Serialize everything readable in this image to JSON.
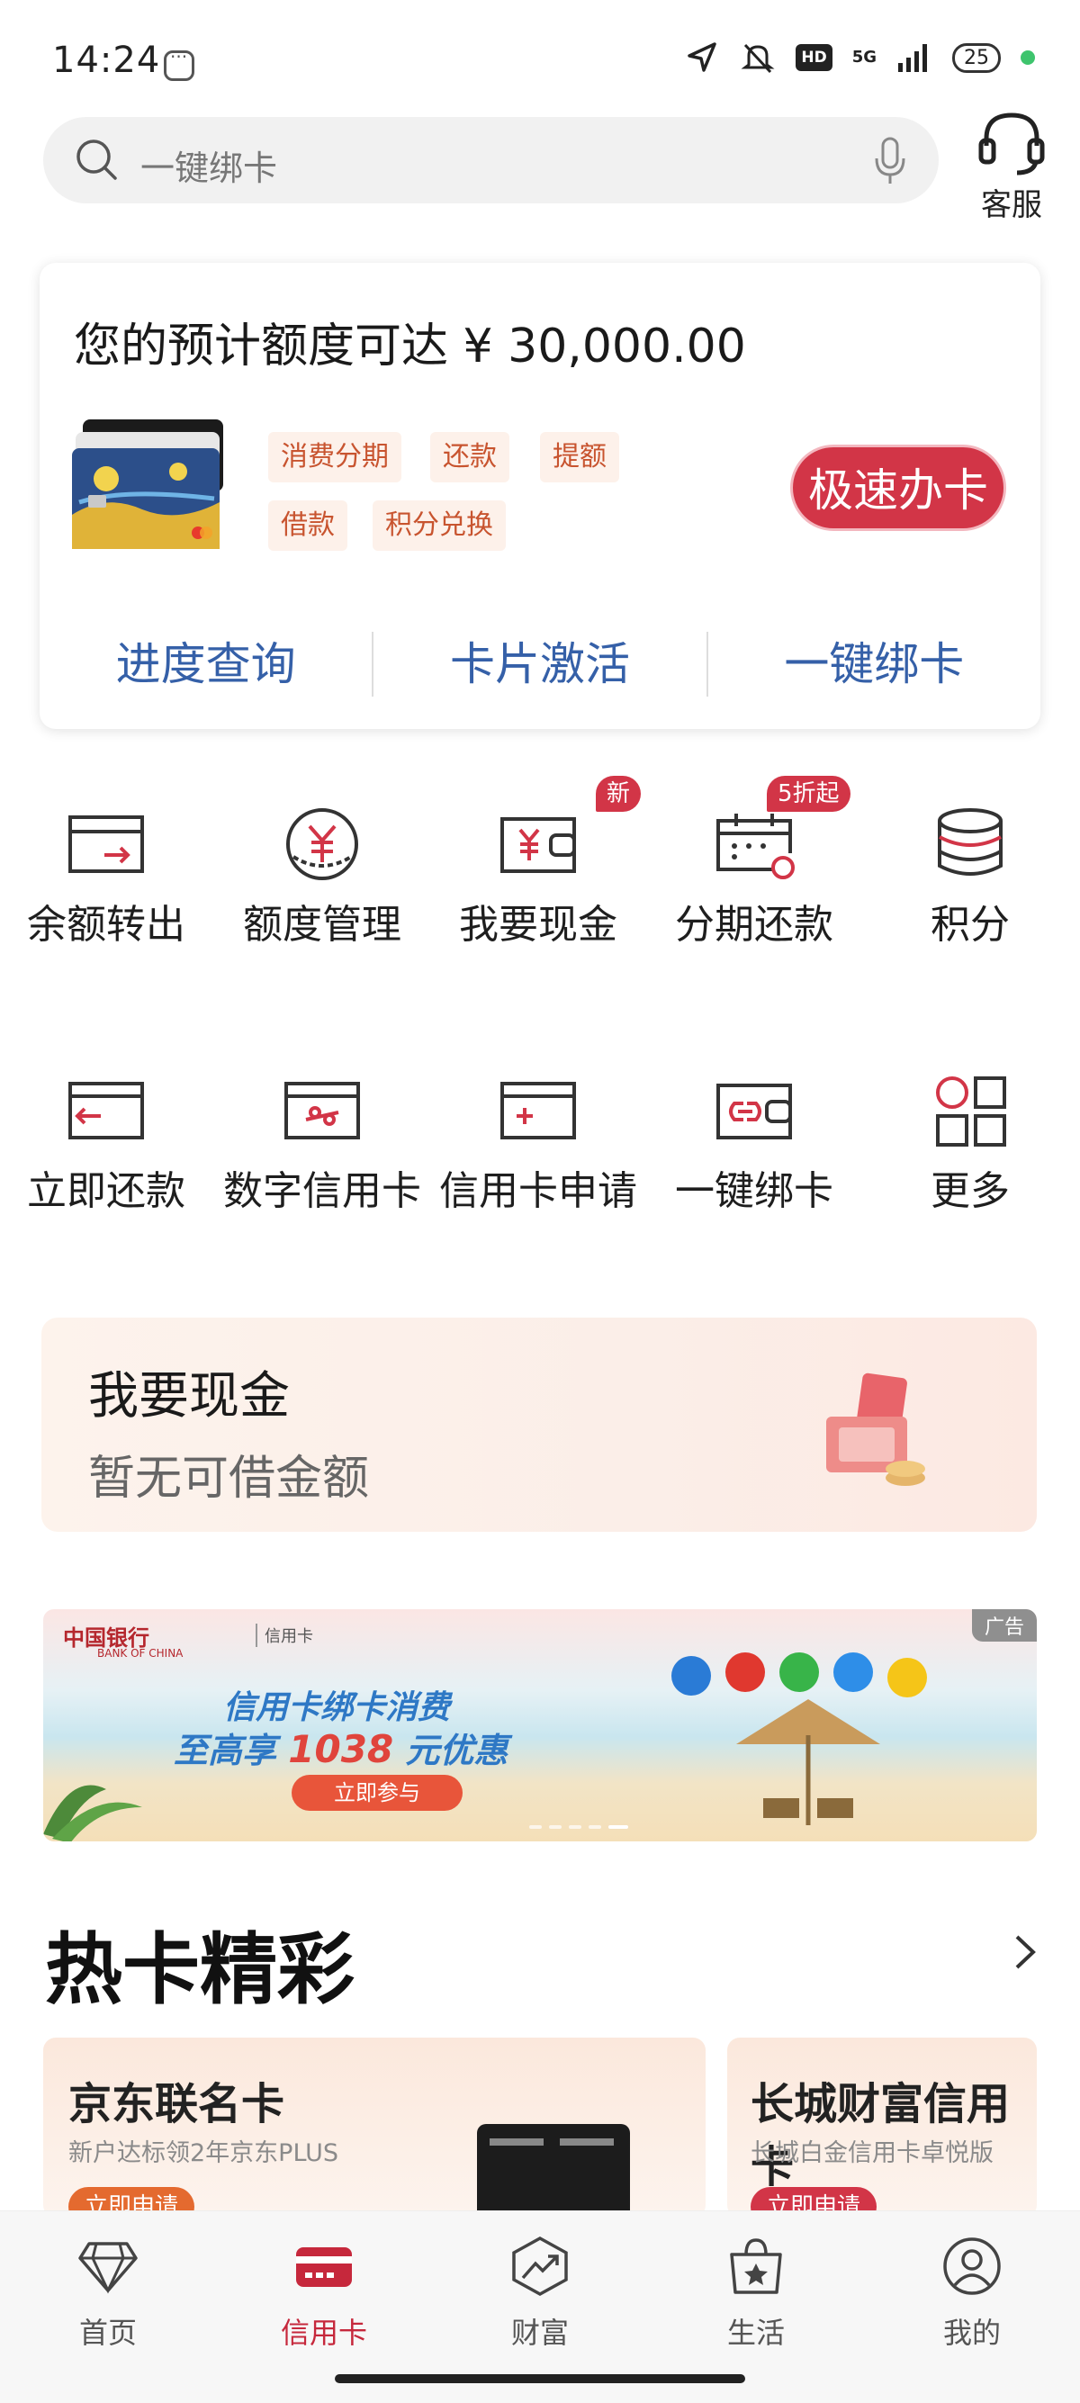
{
  "status_bar": {
    "time": "14:24",
    "network": "5G",
    "hd": "HD",
    "battery": "25",
    "icons": [
      "message-icon",
      "location-icon",
      "mute-icon",
      "signal-icon",
      "battery-icon"
    ]
  },
  "search": {
    "placeholder": "一键绑卡",
    "service_label": "客服"
  },
  "summary": {
    "title": "您的预计额度可达 ¥ 30,000.00",
    "tags": [
      "消费分期",
      "还款",
      "提额",
      "借款",
      "积分兑换"
    ],
    "apply_button": "极速办卡",
    "links": [
      "进度查询",
      "卡片激活",
      "一键绑卡"
    ]
  },
  "grid": {
    "items": [
      {
        "label": "余额转出",
        "icon": "transfer-out-icon",
        "badge": ""
      },
      {
        "label": "额度管理",
        "icon": "credit-limit-icon",
        "badge": ""
      },
      {
        "label": "我要现金",
        "icon": "cash-wallet-icon",
        "badge": "新"
      },
      {
        "label": "分期还款",
        "icon": "installment-icon",
        "badge": "5折起"
      },
      {
        "label": "积分",
        "icon": "points-icon",
        "badge": ""
      },
      {
        "label": "立即还款",
        "icon": "repay-icon",
        "badge": ""
      },
      {
        "label": "数字信用卡",
        "icon": "digital-card-icon",
        "badge": ""
      },
      {
        "label": "信用卡申请",
        "icon": "card-apply-icon",
        "badge": ""
      },
      {
        "label": "一键绑卡",
        "icon": "bind-card-icon",
        "badge": ""
      },
      {
        "label": "更多",
        "icon": "more-grid-icon",
        "badge": ""
      }
    ]
  },
  "cash_card": {
    "title": "我要现金",
    "subtitle": "暂无可借金额"
  },
  "banner": {
    "logo": "中国银行",
    "logo_en": "BANK OF CHINA",
    "brand_sub": "信用卡",
    "ad_label": "广告",
    "line1": "信用卡绑卡消费",
    "line2_prefix": "至高享",
    "line2_number": "1038",
    "line2_suffix": "元优惠",
    "button": "立即参与"
  },
  "hot_section": {
    "title": "热卡精彩",
    "cards": [
      {
        "title": "京东联名卡",
        "subtitle": "新户达标领2年京东PLUS",
        "button": "立即申请"
      },
      {
        "title": "长城财富信用卡",
        "subtitle": "长城白金信用卡卓悦版",
        "button": "立即申请"
      }
    ]
  },
  "bottom_nav": {
    "items": [
      {
        "label": "首页",
        "icon": "diamond-icon",
        "active": false
      },
      {
        "label": "信用卡",
        "icon": "credit-card-icon",
        "active": true
      },
      {
        "label": "财富",
        "icon": "wealth-chart-icon",
        "active": false
      },
      {
        "label": "生活",
        "icon": "shopping-bag-icon",
        "active": false
      },
      {
        "label": "我的",
        "icon": "profile-icon",
        "active": false
      }
    ]
  },
  "colors": {
    "accent_red": "#d23547",
    "link_blue": "#3560a8",
    "tag_text": "#c8542f",
    "tag_bg": "#fdf1ea"
  }
}
